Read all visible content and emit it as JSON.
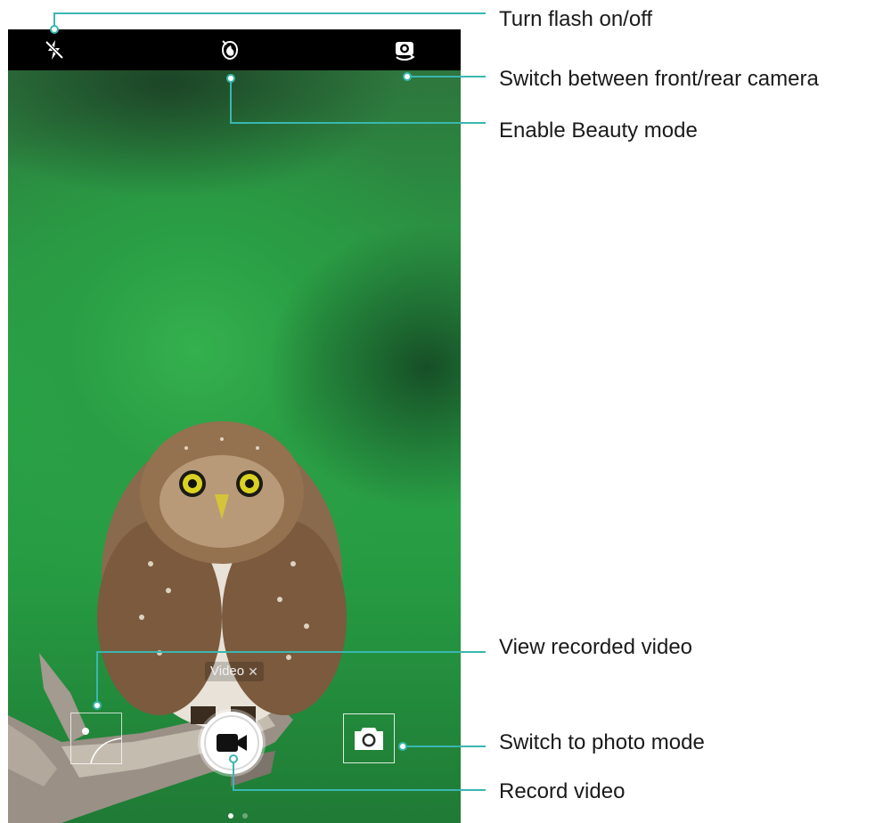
{
  "camera": {
    "mode_chip": {
      "label": "Video",
      "close_glyph": "✕"
    },
    "top_icons": [
      "flash-off-icon",
      "beauty-icon",
      "switch-camera-icon"
    ],
    "bottom_icons": [
      "video-camera-icon",
      "camera-icon"
    ],
    "pager": {
      "pages": 2,
      "active": 0
    }
  },
  "callouts": {
    "flash": "Turn flash on/off",
    "switch_camera": "Switch between front/rear camera",
    "beauty": "Enable Beauty mode",
    "view_video": "View recorded video",
    "photo_mode": "Switch to photo mode",
    "record": "Record video"
  },
  "colors": {
    "callout_line": "#3ab7b0",
    "screen_bg": "#2ba448",
    "topbar": "#000000"
  }
}
